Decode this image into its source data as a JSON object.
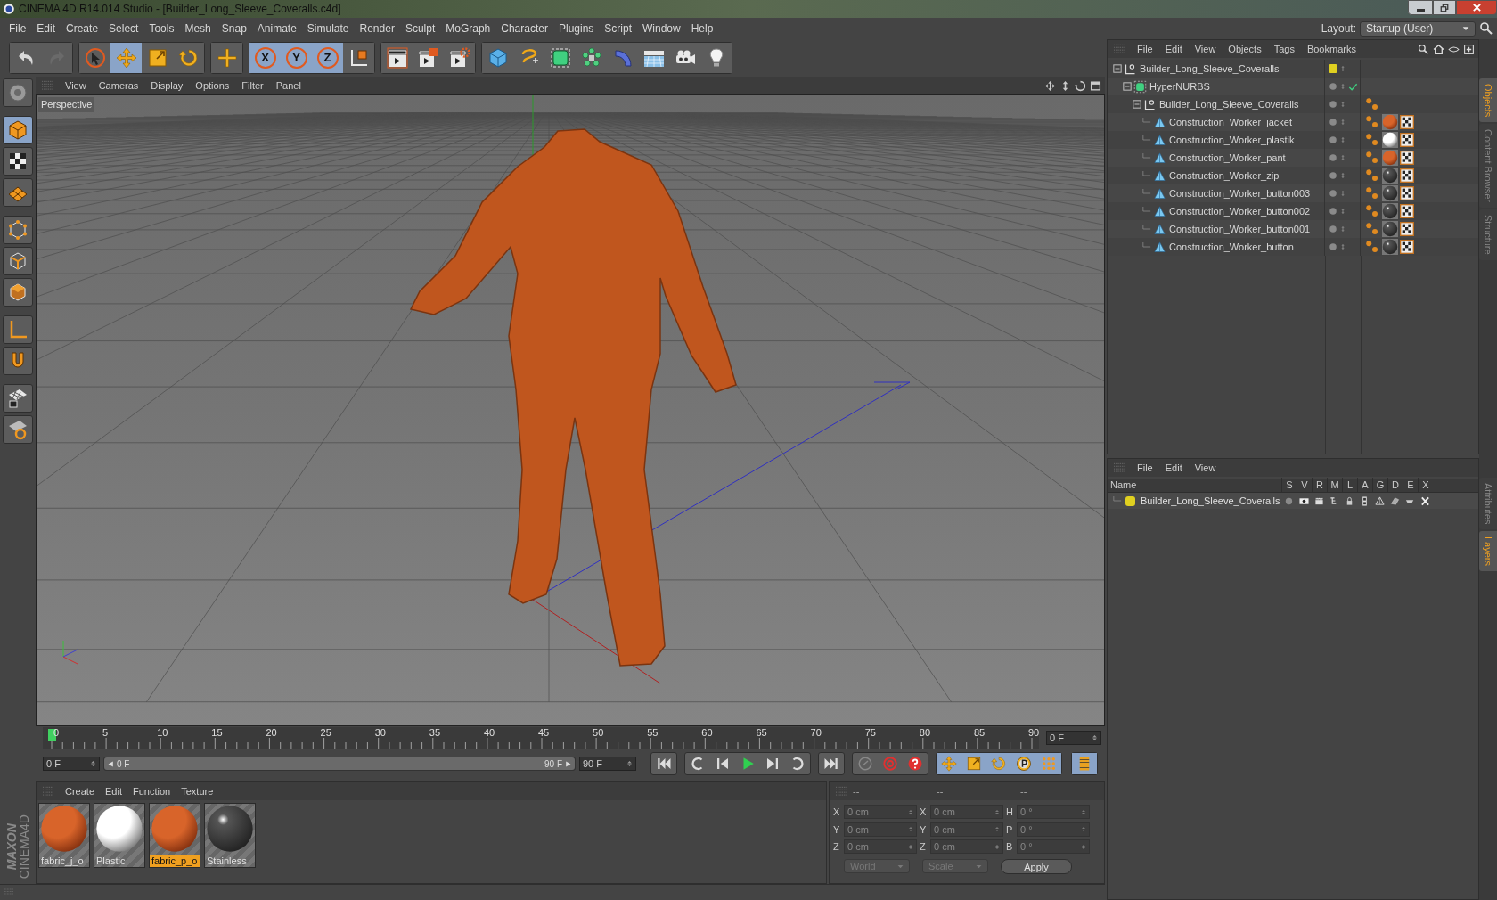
{
  "window": {
    "title": "CINEMA 4D R14.014 Studio - [Builder_Long_Sleeve_Coveralls.c4d]"
  },
  "menu_bar": [
    "File",
    "Edit",
    "Create",
    "Select",
    "Tools",
    "Mesh",
    "Snap",
    "Animate",
    "Simulate",
    "Render",
    "Sculpt",
    "MoGraph",
    "Character",
    "Plugins",
    "Script",
    "Window",
    "Help"
  ],
  "layout": {
    "label": "Layout:",
    "value": "Startup (User)"
  },
  "toolbar": [
    [
      {
        "kind": "undo",
        "selected": false
      },
      {
        "kind": "redo",
        "selected": false
      }
    ],
    [
      {
        "kind": "select",
        "selected": false
      },
      {
        "kind": "move",
        "selected": true
      },
      {
        "kind": "scale",
        "selected": false
      },
      {
        "kind": "rotate",
        "selected": false
      }
    ],
    [
      {
        "kind": "add",
        "selected": false
      }
    ],
    [
      {
        "kind": "axis",
        "label": "X",
        "selected": true
      },
      {
        "kind": "axis",
        "label": "Y",
        "selected": true
      },
      {
        "kind": "axis",
        "label": "Z",
        "selected": true
      },
      {
        "kind": "coords",
        "selected": false
      }
    ],
    [
      {
        "kind": "render-view",
        "selected": false
      },
      {
        "kind": "render-picture",
        "selected": false
      },
      {
        "kind": "render-settings",
        "selected": false
      }
    ],
    [
      {
        "kind": "cube",
        "selected": false
      },
      {
        "kind": "spline",
        "selected": false
      },
      {
        "kind": "nurbs",
        "selected": false
      },
      {
        "kind": "array",
        "selected": false
      },
      {
        "kind": "deformer",
        "selected": false
      },
      {
        "kind": "floor",
        "selected": false
      },
      {
        "kind": "camera",
        "selected": false
      },
      {
        "kind": "light",
        "selected": false
      }
    ]
  ],
  "left_tools": [
    {
      "kind": "view",
      "selected": false
    },
    {
      "kind": "model",
      "selected": true
    },
    {
      "kind": "texture",
      "selected": false
    },
    {
      "kind": "workplane",
      "selected": false
    },
    {
      "kind": "points",
      "selected": false
    },
    {
      "kind": "edges",
      "selected": false
    },
    {
      "kind": "polygons",
      "selected": false
    },
    {
      "kind": "axis",
      "selected": false
    },
    {
      "kind": "magnet",
      "selected": false
    },
    {
      "kind": "lock",
      "selected": false
    },
    {
      "kind": "snap",
      "selected": false
    }
  ],
  "viewport": {
    "menu": [
      "View",
      "Cameras",
      "Display",
      "Options",
      "Filter",
      "Panel"
    ],
    "label": "Perspective"
  },
  "timeline": {
    "ticks": [
      "0",
      "5",
      "10",
      "15",
      "20",
      "25",
      "30",
      "35",
      "40",
      "45",
      "50",
      "55",
      "60",
      "65",
      "70",
      "75",
      "80",
      "85",
      "90"
    ],
    "playhead": {
      "level": 0
    },
    "frame_field": "0 F"
  },
  "transport": {
    "current": "0 F",
    "range_start": "0 F",
    "range_end": "90 F",
    "range_bar": {
      "level": 1
    },
    "end": "90 F"
  },
  "materials": {
    "menu": [
      "Create",
      "Edit",
      "Function",
      "Texture"
    ],
    "items": [
      {
        "name": "fabric_j_o",
        "kind": "fabric",
        "selected": false
      },
      {
        "name": "Plastic",
        "kind": "plastic",
        "selected": false
      },
      {
        "name": "fabric_p_o",
        "kind": "fabric",
        "selected": true
      },
      {
        "name": "Stainless",
        "kind": "metal",
        "selected": false
      }
    ]
  },
  "coordinates": {
    "headers": [
      "--",
      "--",
      "--"
    ],
    "rows": [
      [
        {
          "axis": "X",
          "value": "0 cm"
        },
        {
          "axis": "X",
          "value": "0 cm"
        },
        {
          "axis": "H",
          "value": "0 °"
        }
      ],
      [
        {
          "axis": "Y",
          "value": "0 cm"
        },
        {
          "axis": "Y",
          "value": "0 cm"
        },
        {
          "axis": "P",
          "value": "0 °"
        }
      ],
      [
        {
          "axis": "Z",
          "value": "0 cm"
        },
        {
          "axis": "Z",
          "value": "0 cm"
        },
        {
          "axis": "B",
          "value": "0 °"
        }
      ]
    ],
    "dropdowns": [
      "World",
      "Scale"
    ],
    "apply": "Apply"
  },
  "objects": {
    "menu": [
      "File",
      "Edit",
      "View",
      "Objects",
      "Tags",
      "Bookmarks"
    ],
    "tree": [
      {
        "name": "Builder_Long_Sleeve_Coveralls",
        "kind": "null",
        "color": "#e0d020",
        "children": [
          {
            "name": "HyperNURBS",
            "kind": "hypernurbs",
            "enabled": true,
            "children": [
              {
                "name": "Builder_Long_Sleeve_Coveralls",
                "kind": "null",
                "tags": [
                  {
                    "kind": "phong"
                  }
                ],
                "children": [
                  {
                    "name": "Construction_Worker_jacket",
                    "kind": "polygon",
                    "tags": [
                      {
                        "kind": "phong"
                      },
                      {
                        "kind": "fabric-material"
                      },
                      {
                        "kind": "uvw"
                      }
                    ]
                  },
                  {
                    "name": "Construction_Worker_plastik",
                    "kind": "polygon",
                    "tags": [
                      {
                        "kind": "phong"
                      },
                      {
                        "kind": "plastic-material"
                      },
                      {
                        "kind": "uvw"
                      }
                    ]
                  },
                  {
                    "name": "Construction_Worker_pant",
                    "kind": "polygon",
                    "tags": [
                      {
                        "kind": "phong"
                      },
                      {
                        "kind": "fabric-material"
                      },
                      {
                        "kind": "uvw"
                      }
                    ]
                  },
                  {
                    "name": "Construction_Worker_zip",
                    "kind": "polygon",
                    "tags": [
                      {
                        "kind": "phong"
                      },
                      {
                        "kind": "metal-material"
                      },
                      {
                        "kind": "uvw"
                      }
                    ]
                  },
                  {
                    "name": "Construction_Worker_button003",
                    "kind": "polygon",
                    "tags": [
                      {
                        "kind": "phong"
                      },
                      {
                        "kind": "metal-material"
                      },
                      {
                        "kind": "uvw"
                      }
                    ]
                  },
                  {
                    "name": "Construction_Worker_button002",
                    "kind": "polygon",
                    "tags": [
                      {
                        "kind": "phong"
                      },
                      {
                        "kind": "metal-material"
                      },
                      {
                        "kind": "uvw"
                      }
                    ]
                  },
                  {
                    "name": "Construction_Worker_button001",
                    "kind": "polygon",
                    "tags": [
                      {
                        "kind": "phong"
                      },
                      {
                        "kind": "metal-material"
                      },
                      {
                        "kind": "uvw"
                      }
                    ]
                  },
                  {
                    "name": "Construction_Worker_button",
                    "kind": "polygon",
                    "tags": [
                      {
                        "kind": "phong"
                      },
                      {
                        "kind": "metal-material"
                      },
                      {
                        "kind": "uvw"
                      }
                    ]
                  }
                ]
              }
            ]
          }
        ]
      }
    ]
  },
  "layers": {
    "menu": [
      "File",
      "Edit",
      "View"
    ],
    "columns": [
      "Name",
      "S",
      "V",
      "R",
      "M",
      "L",
      "A",
      "G",
      "D",
      "E",
      "X"
    ],
    "rows": [
      {
        "name": "Builder_Long_Sleeve_Coveralls",
        "color": "#e0d020"
      }
    ]
  },
  "side_tabs_top": [
    {
      "label": "Objects",
      "selected": true
    },
    {
      "label": "Content Browser",
      "selected": false
    },
    {
      "label": "Structure",
      "selected": false
    }
  ],
  "side_tabs_bottom": [
    {
      "label": "Attributes",
      "selected": false
    },
    {
      "label": "Layers",
      "selected": true
    }
  ],
  "brand": {
    "maker": "MAXON",
    "product": "CINEMA4D"
  }
}
